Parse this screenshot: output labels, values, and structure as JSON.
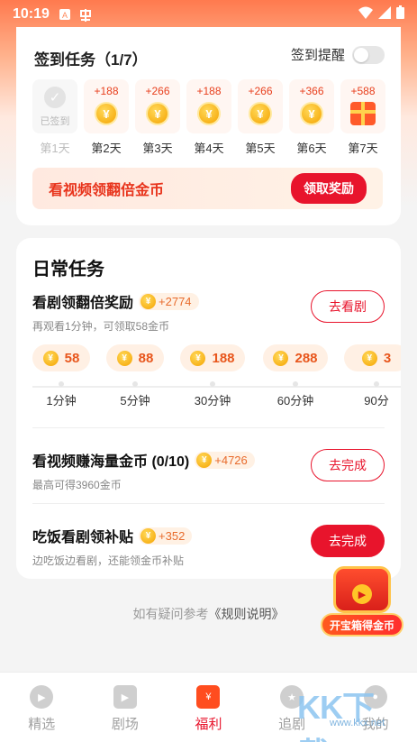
{
  "status_bar": {
    "time": "10:19"
  },
  "signin": {
    "title": "签到任务（1/7）",
    "reminder_label": "签到提醒",
    "days": [
      {
        "amount": "",
        "state_text": "已签到",
        "label": "第1天",
        "kind": "done"
      },
      {
        "amount": "+188",
        "label": "第2天",
        "kind": "coin"
      },
      {
        "amount": "+266",
        "label": "第3天",
        "kind": "coin"
      },
      {
        "amount": "+188",
        "label": "第4天",
        "kind": "coin"
      },
      {
        "amount": "+266",
        "label": "第5天",
        "kind": "coin"
      },
      {
        "amount": "+366",
        "label": "第6天",
        "kind": "coin"
      },
      {
        "amount": "+588",
        "label": "第7天",
        "kind": "gift"
      }
    ],
    "banner_text": "看视频领翻倍金币",
    "banner_button": "领取奖励"
  },
  "daily": {
    "title": "日常任务",
    "tasks": [
      {
        "title": "看剧领翻倍奖励",
        "reward": "+2774",
        "sub": "再观看1分钟，可领取58金币",
        "button": "去看剧"
      },
      {
        "title": "看视频赚海量金币 (0/10)",
        "reward": "+4726",
        "sub": "最高可得3960金币",
        "button": "去完成"
      },
      {
        "title": "吃饭看剧领补贴",
        "reward": "+352",
        "sub": "边吃饭边看剧，还能领金币补贴",
        "button": "去完成"
      }
    ],
    "milestones": [
      {
        "coins": "58",
        "label": "1分钟"
      },
      {
        "coins": "88",
        "label": "5分钟"
      },
      {
        "coins": "188",
        "label": "30分钟"
      },
      {
        "coins": "288",
        "label": "60分钟"
      },
      {
        "coins": "3",
        "label": "90分"
      }
    ]
  },
  "footer": {
    "prefix": "如有疑问参考",
    "link": "《规则说明》"
  },
  "chest": {
    "label": "开宝箱得金币"
  },
  "tabs": [
    {
      "label": "精选",
      "icon": "play-circle-icon"
    },
    {
      "label": "剧场",
      "icon": "tv-icon"
    },
    {
      "label": "福利",
      "icon": "red-envelope-icon",
      "active": true
    },
    {
      "label": "追剧",
      "icon": "star-icon"
    },
    {
      "label": "我的",
      "icon": "profile-icon"
    }
  ],
  "watermark": {
    "text": "KK下载",
    "url": "www.kkx.net"
  },
  "colors": {
    "accent": "#e8142c",
    "coin": "#f5a300",
    "header_gradient": "#ff7a4e"
  }
}
